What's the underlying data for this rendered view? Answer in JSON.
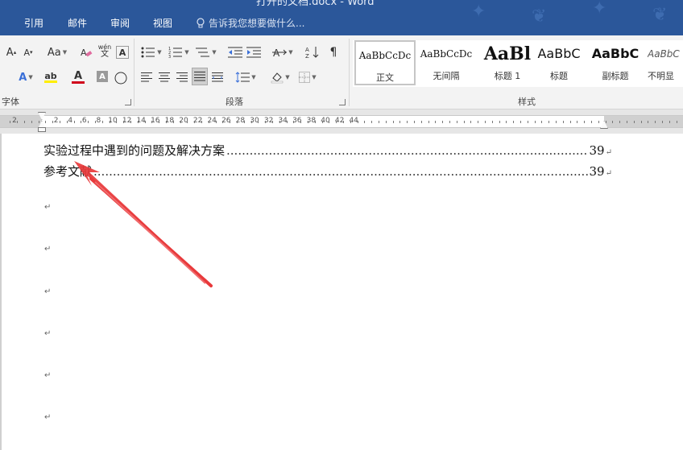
{
  "window": {
    "title": "打开的文档.docx - Word"
  },
  "tabs": [
    "引用",
    "邮件",
    "审阅",
    "视图"
  ],
  "tell_me": "告诉我您想要做什么...",
  "groups": {
    "font": "字体",
    "paragraph": "段落",
    "styles": "样式"
  },
  "font_tools": {
    "grow": "A",
    "shrink": "A",
    "case": "Aa",
    "phonetic": "wén",
    "border": "A",
    "effects": "A",
    "highlight": "ab",
    "color": "A",
    "shade": "A",
    "enclose": "字"
  },
  "styles": [
    {
      "sample": "AaBbCcDc",
      "name": "正文"
    },
    {
      "sample": "AaBbCcDc",
      "name": "无间隔"
    },
    {
      "sample": "AaBl",
      "name": "标题 1"
    },
    {
      "sample": "AaBbC",
      "name": "标题"
    },
    {
      "sample": "AaBbC",
      "name": "副标题"
    },
    {
      "sample": "AaBbC",
      "name": "不明显"
    }
  ],
  "ruler": {
    "numbers": [
      "2",
      "2",
      "4",
      "6",
      "8",
      "10",
      "12",
      "14",
      "16",
      "18",
      "20",
      "22",
      "24",
      "26",
      "28",
      "30",
      "32",
      "34",
      "36",
      "38",
      "40",
      "42",
      "44"
    ]
  },
  "document": {
    "toc": [
      {
        "text": "实验过程中遇到的问题及解决方案",
        "page": "39"
      },
      {
        "text": "参考文献",
        "page": "39"
      }
    ],
    "paragraph_mark": "↵"
  },
  "colors": {
    "title_bar": "#2b579a",
    "arrow": "#e8393b",
    "font_color": "#d0021b",
    "highlight": "#ffee00"
  }
}
